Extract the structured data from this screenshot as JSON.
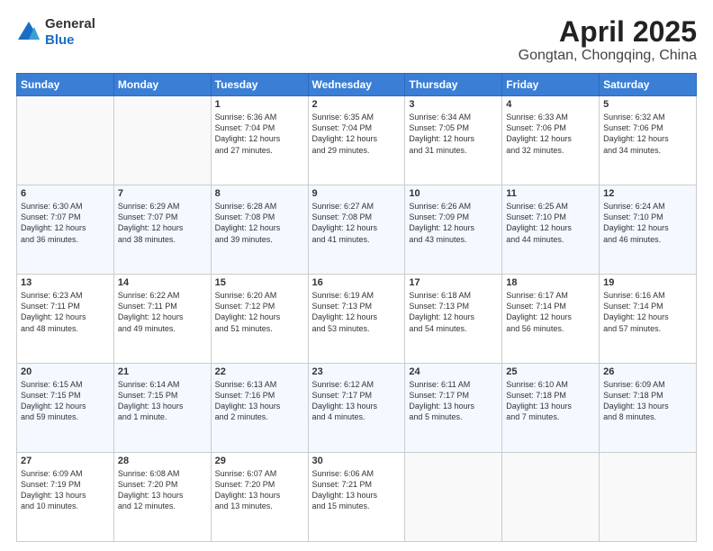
{
  "header": {
    "logo_general": "General",
    "logo_blue": "Blue",
    "title": "April 2025",
    "subtitle": "Gongtan, Chongqing, China"
  },
  "calendar": {
    "days_of_week": [
      "Sunday",
      "Monday",
      "Tuesday",
      "Wednesday",
      "Thursday",
      "Friday",
      "Saturday"
    ],
    "weeks": [
      [
        {
          "day": "",
          "content": ""
        },
        {
          "day": "",
          "content": ""
        },
        {
          "day": "1",
          "content": "Sunrise: 6:36 AM\nSunset: 7:04 PM\nDaylight: 12 hours\nand 27 minutes."
        },
        {
          "day": "2",
          "content": "Sunrise: 6:35 AM\nSunset: 7:04 PM\nDaylight: 12 hours\nand 29 minutes."
        },
        {
          "day": "3",
          "content": "Sunrise: 6:34 AM\nSunset: 7:05 PM\nDaylight: 12 hours\nand 31 minutes."
        },
        {
          "day": "4",
          "content": "Sunrise: 6:33 AM\nSunset: 7:06 PM\nDaylight: 12 hours\nand 32 minutes."
        },
        {
          "day": "5",
          "content": "Sunrise: 6:32 AM\nSunset: 7:06 PM\nDaylight: 12 hours\nand 34 minutes."
        }
      ],
      [
        {
          "day": "6",
          "content": "Sunrise: 6:30 AM\nSunset: 7:07 PM\nDaylight: 12 hours\nand 36 minutes."
        },
        {
          "day": "7",
          "content": "Sunrise: 6:29 AM\nSunset: 7:07 PM\nDaylight: 12 hours\nand 38 minutes."
        },
        {
          "day": "8",
          "content": "Sunrise: 6:28 AM\nSunset: 7:08 PM\nDaylight: 12 hours\nand 39 minutes."
        },
        {
          "day": "9",
          "content": "Sunrise: 6:27 AM\nSunset: 7:08 PM\nDaylight: 12 hours\nand 41 minutes."
        },
        {
          "day": "10",
          "content": "Sunrise: 6:26 AM\nSunset: 7:09 PM\nDaylight: 12 hours\nand 43 minutes."
        },
        {
          "day": "11",
          "content": "Sunrise: 6:25 AM\nSunset: 7:10 PM\nDaylight: 12 hours\nand 44 minutes."
        },
        {
          "day": "12",
          "content": "Sunrise: 6:24 AM\nSunset: 7:10 PM\nDaylight: 12 hours\nand 46 minutes."
        }
      ],
      [
        {
          "day": "13",
          "content": "Sunrise: 6:23 AM\nSunset: 7:11 PM\nDaylight: 12 hours\nand 48 minutes."
        },
        {
          "day": "14",
          "content": "Sunrise: 6:22 AM\nSunset: 7:11 PM\nDaylight: 12 hours\nand 49 minutes."
        },
        {
          "day": "15",
          "content": "Sunrise: 6:20 AM\nSunset: 7:12 PM\nDaylight: 12 hours\nand 51 minutes."
        },
        {
          "day": "16",
          "content": "Sunrise: 6:19 AM\nSunset: 7:13 PM\nDaylight: 12 hours\nand 53 minutes."
        },
        {
          "day": "17",
          "content": "Sunrise: 6:18 AM\nSunset: 7:13 PM\nDaylight: 12 hours\nand 54 minutes."
        },
        {
          "day": "18",
          "content": "Sunrise: 6:17 AM\nSunset: 7:14 PM\nDaylight: 12 hours\nand 56 minutes."
        },
        {
          "day": "19",
          "content": "Sunrise: 6:16 AM\nSunset: 7:14 PM\nDaylight: 12 hours\nand 57 minutes."
        }
      ],
      [
        {
          "day": "20",
          "content": "Sunrise: 6:15 AM\nSunset: 7:15 PM\nDaylight: 12 hours\nand 59 minutes."
        },
        {
          "day": "21",
          "content": "Sunrise: 6:14 AM\nSunset: 7:15 PM\nDaylight: 13 hours\nand 1 minute."
        },
        {
          "day": "22",
          "content": "Sunrise: 6:13 AM\nSunset: 7:16 PM\nDaylight: 13 hours\nand 2 minutes."
        },
        {
          "day": "23",
          "content": "Sunrise: 6:12 AM\nSunset: 7:17 PM\nDaylight: 13 hours\nand 4 minutes."
        },
        {
          "day": "24",
          "content": "Sunrise: 6:11 AM\nSunset: 7:17 PM\nDaylight: 13 hours\nand 5 minutes."
        },
        {
          "day": "25",
          "content": "Sunrise: 6:10 AM\nSunset: 7:18 PM\nDaylight: 13 hours\nand 7 minutes."
        },
        {
          "day": "26",
          "content": "Sunrise: 6:09 AM\nSunset: 7:18 PM\nDaylight: 13 hours\nand 8 minutes."
        }
      ],
      [
        {
          "day": "27",
          "content": "Sunrise: 6:09 AM\nSunset: 7:19 PM\nDaylight: 13 hours\nand 10 minutes."
        },
        {
          "day": "28",
          "content": "Sunrise: 6:08 AM\nSunset: 7:20 PM\nDaylight: 13 hours\nand 12 minutes."
        },
        {
          "day": "29",
          "content": "Sunrise: 6:07 AM\nSunset: 7:20 PM\nDaylight: 13 hours\nand 13 minutes."
        },
        {
          "day": "30",
          "content": "Sunrise: 6:06 AM\nSunset: 7:21 PM\nDaylight: 13 hours\nand 15 minutes."
        },
        {
          "day": "",
          "content": ""
        },
        {
          "day": "",
          "content": ""
        },
        {
          "day": "",
          "content": ""
        }
      ]
    ]
  }
}
